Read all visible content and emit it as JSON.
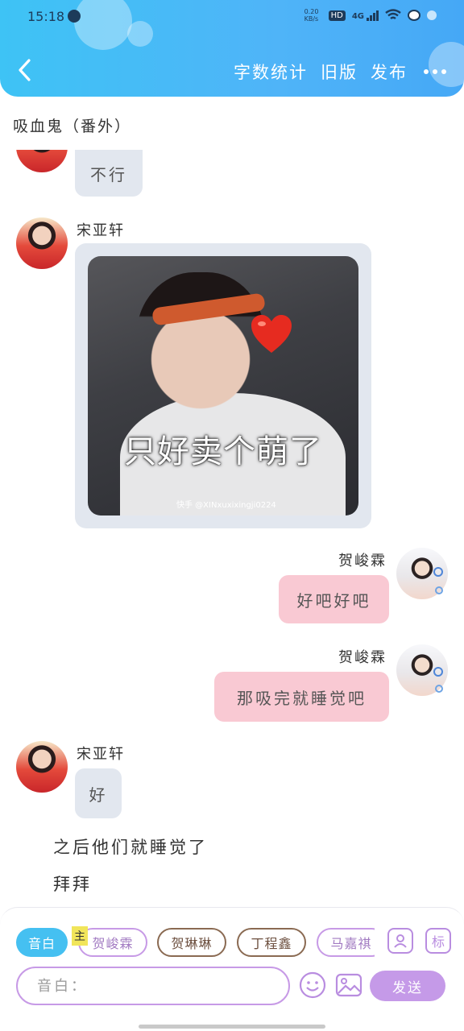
{
  "status_bar": {
    "time": "15:18",
    "speed": "0.20 KB/s",
    "hd": "HD",
    "net": "4G"
  },
  "header": {
    "word_count": "字数统计",
    "old_version": "旧版",
    "publish": "发布"
  },
  "doc_title": "吸血鬼（番外）",
  "messages": [
    {
      "side": "left",
      "text": "不行"
    },
    {
      "side": "left",
      "name": "宋亚轩",
      "image_caption": "只好卖个萌了",
      "image_watermark": "快手 @XINxuxixingji0224"
    },
    {
      "side": "right",
      "name": "贺峻霖",
      "text": "好吧好吧"
    },
    {
      "side": "right",
      "name": "贺峻霖",
      "text": "那吸完就睡觉吧"
    },
    {
      "side": "left",
      "name": "宋亚轩",
      "text": "好"
    }
  ],
  "narration": [
    "之后他们就睡觉了",
    "拜拜"
  ],
  "bottom": {
    "chips": [
      "音白",
      "贺峻霖",
      "贺琳琳",
      "丁程鑫",
      "马嘉祺"
    ],
    "main_tag": "主",
    "mark_label": "标",
    "input_placeholder": "音白：",
    "send_label": "发送"
  }
}
